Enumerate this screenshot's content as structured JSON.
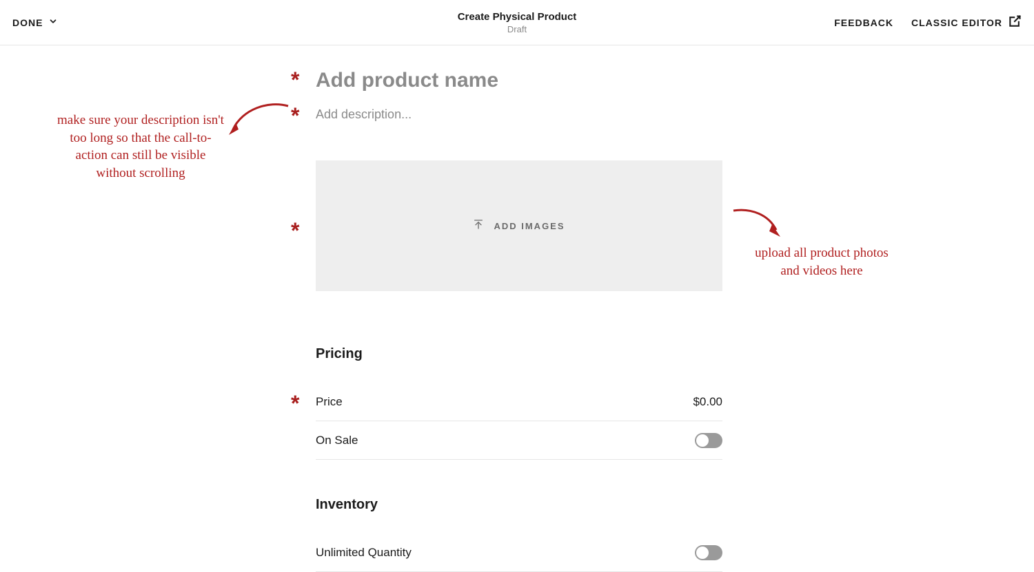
{
  "header": {
    "done_label": "DONE",
    "title": "Create Physical Product",
    "subtitle": "Draft",
    "feedback_label": "FEEDBACK",
    "classic_editor_label": "CLASSIC EDITOR"
  },
  "product": {
    "name_placeholder": "Add product name",
    "description_placeholder": "Add description...",
    "add_images_label": "ADD IMAGES"
  },
  "pricing": {
    "section_title": "Pricing",
    "price_label": "Price",
    "price_value": "$0.00",
    "on_sale_label": "On Sale"
  },
  "inventory": {
    "section_title": "Inventory",
    "unlimited_label": "Unlimited Quantity"
  },
  "annotations": {
    "left": "make sure your description isn't too long so that the call-to-action can still be visible without scrolling",
    "right": "upload all product photos and videos here"
  }
}
